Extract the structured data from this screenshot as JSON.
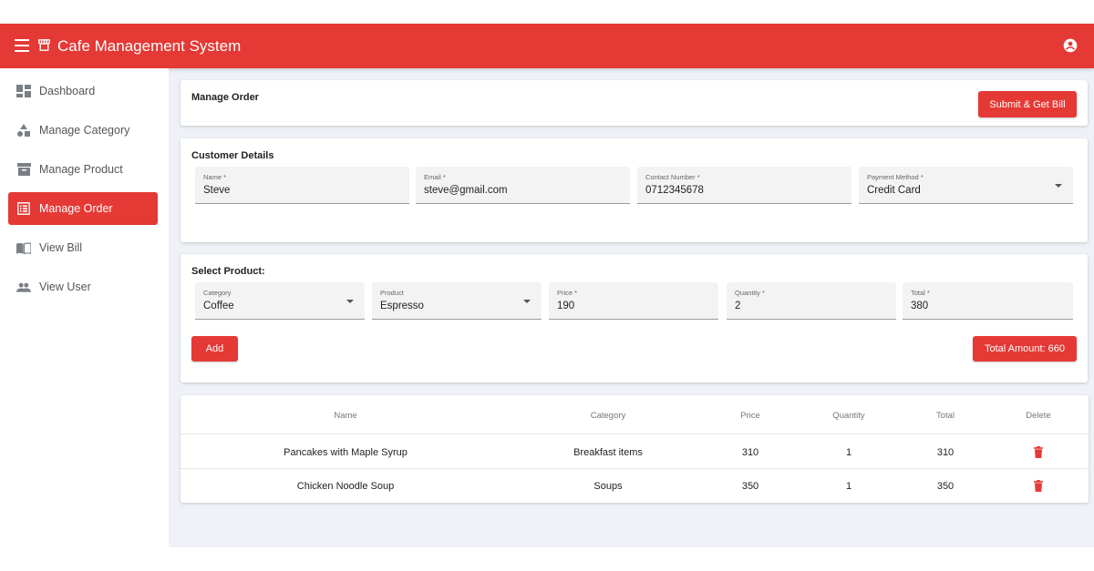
{
  "app": {
    "title": "Cafe Management System"
  },
  "colors": {
    "primary": "#e53935",
    "background": "#eef2f6"
  },
  "icons": {
    "menu": "menu-icon",
    "store": "store-icon",
    "account": "account-circle-icon"
  },
  "sidebar": {
    "items": [
      {
        "label": "Dashboard",
        "icon": "dashboard-icon",
        "active": false
      },
      {
        "label": "Manage Category",
        "icon": "category-icon",
        "active": false
      },
      {
        "label": "Manage Product",
        "icon": "inventory-icon",
        "active": false
      },
      {
        "label": "Manage Order",
        "icon": "list-alt-icon",
        "active": true
      },
      {
        "label": "View Bill",
        "icon": "import-contacts-icon",
        "active": false
      },
      {
        "label": "View User",
        "icon": "people-icon",
        "active": false
      }
    ]
  },
  "header_card": {
    "title": "Manage Order",
    "submit_label": "Submit & Get Bill"
  },
  "customer": {
    "title": "Customer Details",
    "fields": {
      "name": {
        "label": "Name *",
        "value": "Steve"
      },
      "email": {
        "label": "Email *",
        "value": "steve@gmail.com"
      },
      "contact": {
        "label": "Contact Number *",
        "value": "0712345678"
      },
      "payment": {
        "label": "Payment Method *",
        "value": "Credit Card"
      }
    }
  },
  "product": {
    "title": "Select Product:",
    "fields": {
      "category": {
        "label": "Category",
        "value": "Coffee"
      },
      "product": {
        "label": "Product",
        "value": "Espresso"
      },
      "price": {
        "label": "Price *",
        "value": "190"
      },
      "quantity": {
        "label": "Quantity *",
        "value": "2"
      },
      "total": {
        "label": "Total *",
        "value": "380"
      }
    },
    "add_label": "Add",
    "total_amount_label": "Total Amount: 660"
  },
  "table": {
    "headers": [
      "Name",
      "Category",
      "Price",
      "Quantity",
      "Total",
      "Delete"
    ],
    "rows": [
      {
        "name": "Pancakes with Maple Syrup",
        "category": "Breakfast items",
        "price": "310",
        "quantity": "1",
        "total": "310"
      },
      {
        "name": "Chicken Noodle Soup",
        "category": "Soups",
        "price": "350",
        "quantity": "1",
        "total": "350"
      }
    ]
  }
}
